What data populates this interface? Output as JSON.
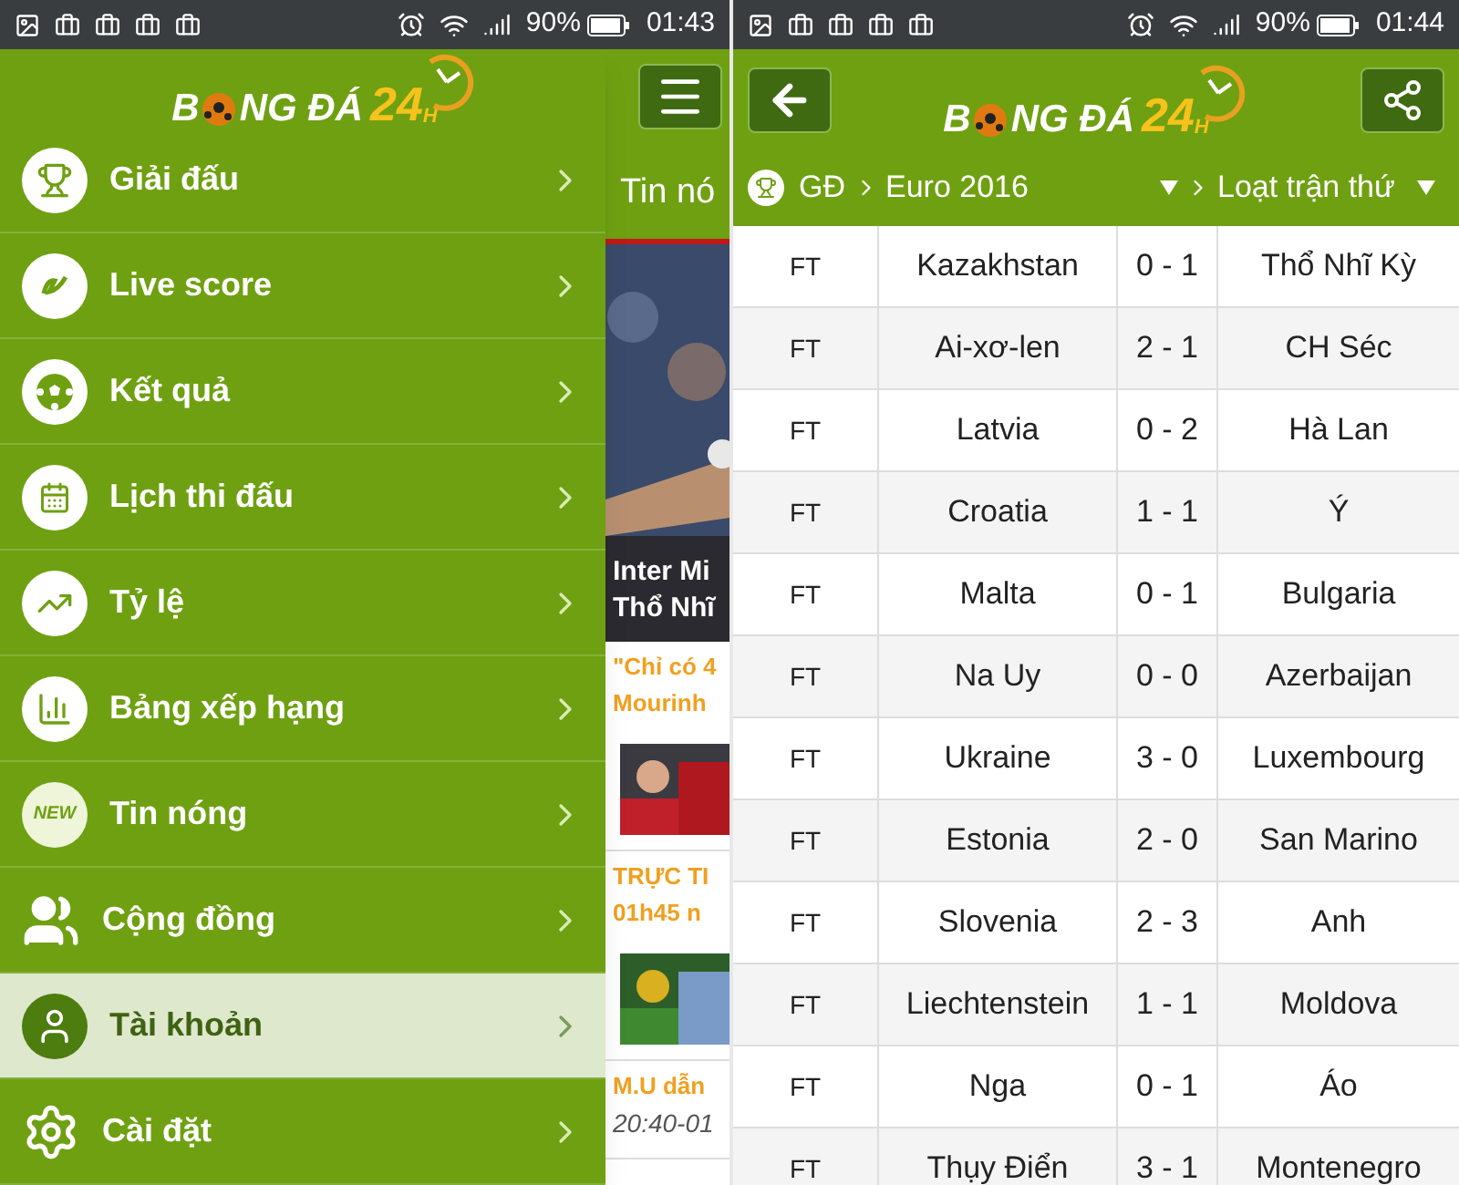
{
  "left_screen": {
    "status_bar": {
      "battery": "90%",
      "time": "01:43"
    },
    "logo": {
      "start": "B",
      "rest": "NG ĐÁ",
      "number": "24",
      "suffix": "H"
    },
    "menu": [
      {
        "label": "Giải đấu",
        "selected": false
      },
      {
        "label": "Live score",
        "selected": false
      },
      {
        "label": "Kết quả",
        "selected": false
      },
      {
        "label": "Lịch thi đấu",
        "selected": false
      },
      {
        "label": "Tỷ lệ",
        "selected": false
      },
      {
        "label": "Bảng xếp hạng",
        "selected": false
      },
      {
        "label": "Tin nóng",
        "badge": "NEW",
        "selected": false
      },
      {
        "label": "Cộng đồng",
        "selected": false
      },
      {
        "label": "Tài khoản",
        "selected": true
      },
      {
        "label": "Cài đặt",
        "selected": false
      }
    ],
    "behind": {
      "title": "Tin nó",
      "headline": [
        "Inter Mi",
        "Thổ Nhĩ"
      ],
      "articles": [
        {
          "title": [
            "\"Chỉ có 4",
            "Mourinh"
          ],
          "kind": "picture"
        },
        {
          "title": [
            "TRỰC TI",
            "01h45 n"
          ],
          "kind": "picture"
        },
        {
          "title": [
            "M.U dẫn"
          ],
          "time": "20:40-01"
        }
      ]
    }
  },
  "right_screen": {
    "status_bar": {
      "battery": "90%",
      "time": "01:44"
    },
    "logo": {
      "start": "B",
      "rest": "NG ĐÁ",
      "number": "24",
      "suffix": "H"
    },
    "breadcrumb": {
      "root": "GĐ",
      "competition": "Euro 2016",
      "round": "Loạt trận thứ"
    },
    "matches": [
      {
        "status": "FT",
        "home": "Kazakhstan",
        "score": "0 - 1",
        "away": "Thổ Nhĩ Kỳ"
      },
      {
        "status": "FT",
        "home": "Ai-xơ-len",
        "score": "2 - 1",
        "away": "CH Séc"
      },
      {
        "status": "FT",
        "home": "Latvia",
        "score": "0 - 2",
        "away": "Hà Lan"
      },
      {
        "status": "FT",
        "home": "Croatia",
        "score": "1 - 1",
        "away": "Ý"
      },
      {
        "status": "FT",
        "home": "Malta",
        "score": "0 - 1",
        "away": "Bulgaria"
      },
      {
        "status": "FT",
        "home": "Na Uy",
        "score": "0 - 0",
        "away": "Azerbaijan"
      },
      {
        "status": "FT",
        "home": "Ukraine",
        "score": "3 - 0",
        "away": "Luxembourg"
      },
      {
        "status": "FT",
        "home": "Estonia",
        "score": "2 - 0",
        "away": "San Marino"
      },
      {
        "status": "FT",
        "home": "Slovenia",
        "score": "2 - 3",
        "away": "Anh"
      },
      {
        "status": "FT",
        "home": "Liechtenstein",
        "score": "1 - 1",
        "away": "Moldova"
      },
      {
        "status": "FT",
        "home": "Nga",
        "score": "0 - 1",
        "away": "Áo"
      },
      {
        "status": "FT",
        "home": "Thụy Điển",
        "score": "3 - 1",
        "away": "Montenegro"
      }
    ]
  }
}
